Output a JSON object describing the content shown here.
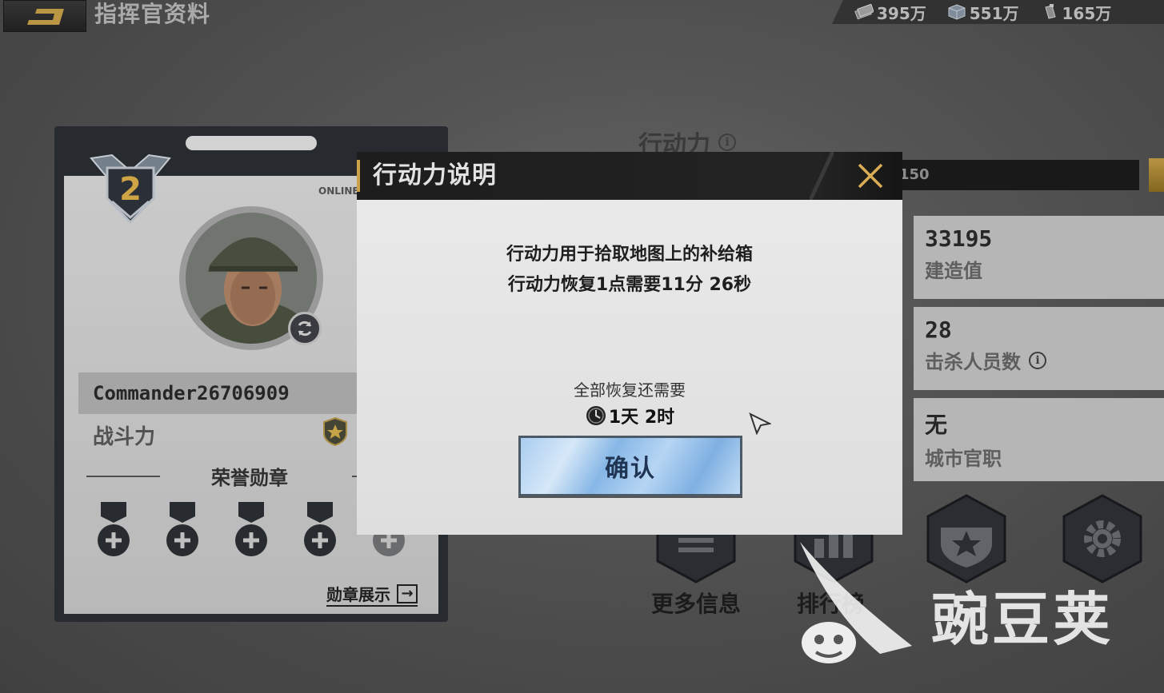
{
  "topbar": {
    "title": "指挥官资料",
    "resources": [
      {
        "icon": "cash-icon",
        "value": "395万"
      },
      {
        "icon": "crate-icon",
        "value": "551万"
      },
      {
        "icon": "fuel-icon",
        "value": "165万"
      }
    ]
  },
  "profile": {
    "rank": "2",
    "status": "ONLINE",
    "name": "Commander26706909",
    "power_label": "战斗力",
    "medals_title": "荣誉勋章",
    "medals_link": "勋章展示"
  },
  "action_points": {
    "label": "行动力",
    "bar_text": "150"
  },
  "stats": [
    {
      "value": "33195",
      "label": "建造值"
    },
    {
      "value": "28",
      "label": "击杀人员数"
    },
    {
      "value": "无",
      "label": "城市官职"
    }
  ],
  "bottom_buttons": [
    {
      "label": "更多信息"
    },
    {
      "label": "排行榜"
    }
  ],
  "modal": {
    "title": "行动力说明",
    "desc_line1": "行动力用于拾取地图上的补给箱",
    "desc_line2": "行动力恢复1点需要11分 26秒",
    "remain_label": "全部恢复还需要",
    "remain_time": "1天 2时",
    "confirm": "确认"
  },
  "watermark": {
    "text": "豌豆荚"
  },
  "colors": {
    "accent_gold": "#c9a24a",
    "confirm_blue": "#87b7e6"
  }
}
